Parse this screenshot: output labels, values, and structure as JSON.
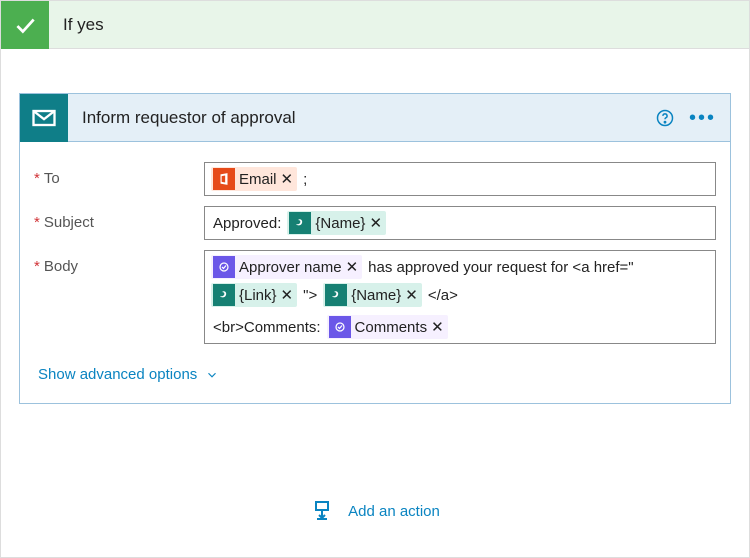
{
  "condition": {
    "title": "If yes"
  },
  "card": {
    "title": "Inform requestor of approval",
    "help": "?"
  },
  "labels": {
    "to": "To",
    "subject": "Subject",
    "body": "Body"
  },
  "fields": {
    "to": {
      "tokens": {
        "email": "Email"
      },
      "trailing": ";"
    },
    "subject": {
      "prefix": "Approved:",
      "tokens": {
        "name": "{Name}"
      }
    },
    "body": {
      "tokens": {
        "approver": "Approver name",
        "link": "{Link}",
        "name": "{Name}",
        "comments": "Comments"
      },
      "text1": "has approved your request for <a href=\"",
      "text2": "\">",
      "text3": "</a>",
      "text4": "<br>Comments:"
    }
  },
  "advanced": "Show advanced options",
  "addAction": "Add an action"
}
